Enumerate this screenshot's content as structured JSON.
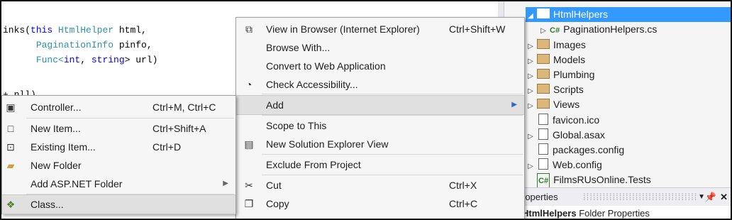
{
  "editor": {
    "lines": [
      {
        "prefix": "inks(",
        "kw": "this ",
        "type": "HtmlHelper",
        "rest": " html,"
      },
      {
        "prefix": "      ",
        "kw": "",
        "type": "PaginationInfo",
        "rest": " pinfo,"
      },
      {
        "prefix": "      ",
        "kw": "",
        "type": "Func<",
        "type2": "int",
        "mid": ", ",
        "type3": "string",
        "rest": "> url)"
      },
      {
        "partial": "+ nll)"
      }
    ]
  },
  "solution_explorer": {
    "items": [
      {
        "label": "HtmlHelpers",
        "expanded": true,
        "selected": true,
        "kind": "folder"
      },
      {
        "label": "PaginationHelpers.cs",
        "kind": "cs"
      },
      {
        "label": "Images",
        "kind": "folder"
      },
      {
        "label": "Models",
        "kind": "folder"
      },
      {
        "label": "Plumbing",
        "kind": "folder"
      },
      {
        "label": "Scripts",
        "kind": "folder"
      },
      {
        "label": "Views",
        "kind": "folder"
      },
      {
        "label": "favicon.ico",
        "kind": "file"
      },
      {
        "label": "Global.asax",
        "kind": "file"
      },
      {
        "label": "packages.config",
        "kind": "file"
      },
      {
        "label": "Web.config",
        "kind": "file"
      },
      {
        "label": "FilmsRUsOnline.Tests",
        "kind": "project"
      }
    ]
  },
  "properties": {
    "header": "roperties",
    "title": "HtmlHelpers",
    "title_suffix": " Folder Properties"
  },
  "context_menu": {
    "items": [
      {
        "label": "View in Browser (Internet Explorer)",
        "shortcut": "Ctrl+Shift+W",
        "icon": "browser-icon"
      },
      {
        "label": "Browse With...",
        "shortcut": ""
      },
      {
        "label": "Convert to Web Application",
        "shortcut": ""
      },
      {
        "label": "Check Accessibility...",
        "shortcut": "",
        "icon": "accessibility-icon"
      },
      {
        "label": "Add",
        "shortcut": "",
        "submenu": true,
        "highlighted": true
      },
      {
        "label": "Scope to This",
        "shortcut": ""
      },
      {
        "label": "New Solution Explorer View",
        "shortcut": "",
        "icon": "new-view-icon"
      },
      {
        "label": "Exclude From Project",
        "shortcut": ""
      },
      {
        "label": "Cut",
        "shortcut": "Ctrl+X",
        "icon": "scissors-icon"
      },
      {
        "label": "Copy",
        "shortcut": "Ctrl+C",
        "icon": "copy-icon"
      }
    ]
  },
  "add_submenu": {
    "items": [
      {
        "label": "Controller...",
        "shortcut": "Ctrl+M, Ctrl+C",
        "icon": "controller-icon"
      },
      {
        "label": "New Item...",
        "shortcut": "Ctrl+Shift+A",
        "icon": "new-item-icon"
      },
      {
        "label": "Existing Item...",
        "shortcut": "Ctrl+D",
        "icon": "existing-item-icon"
      },
      {
        "label": "New Folder",
        "shortcut": "",
        "icon": "new-folder-icon"
      },
      {
        "label": "Add ASP.NET Folder",
        "shortcut": "",
        "submenu": true
      },
      {
        "label": "Class...",
        "shortcut": "",
        "icon": "class-icon",
        "highlighted": true
      }
    ]
  },
  "colors": {
    "selection": "#3399ff",
    "menu_bg": "#f6f6f6",
    "keyword": "#0000ff",
    "type": "#2b91af"
  }
}
